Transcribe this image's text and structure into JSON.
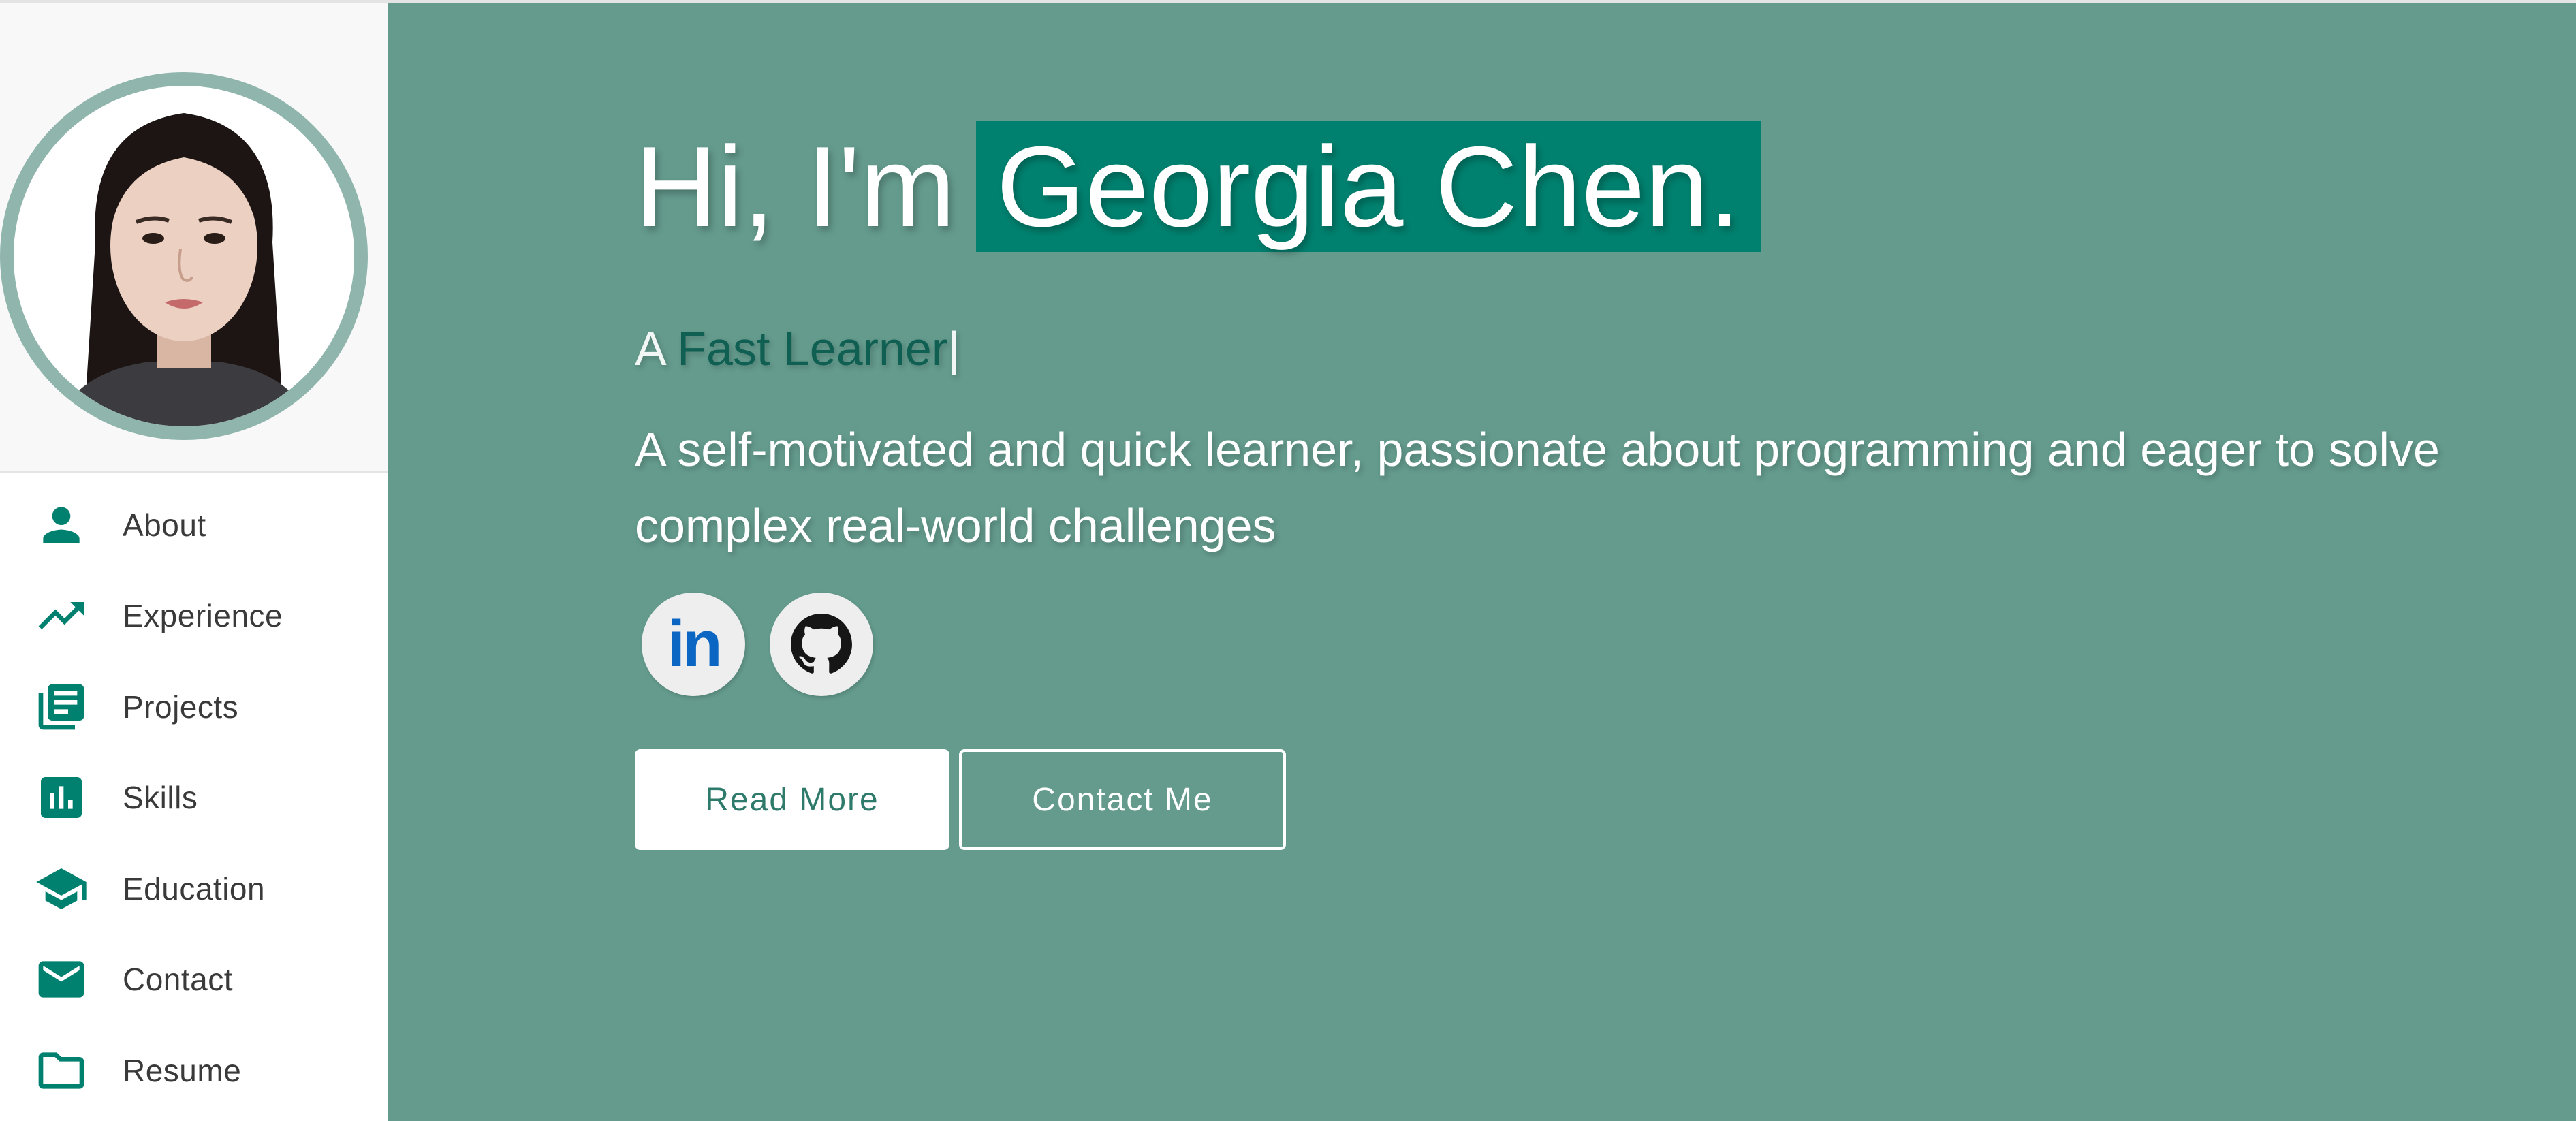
{
  "profile": {
    "avatar_alt": "Georgia Chen profile photo"
  },
  "sidebar": {
    "items": [
      {
        "label": "About",
        "icon": "person-icon"
      },
      {
        "label": "Experience",
        "icon": "trending-up-icon"
      },
      {
        "label": "Projects",
        "icon": "library-books-icon"
      },
      {
        "label": "Skills",
        "icon": "bar-chart-icon"
      },
      {
        "label": "Education",
        "icon": "graduation-cap-icon"
      },
      {
        "label": "Contact",
        "icon": "mail-icon"
      },
      {
        "label": "Resume",
        "icon": "folder-icon"
      }
    ]
  },
  "hero": {
    "greeting": "Hi, I'm",
    "name": "Georgia Chen.",
    "subtitle_prefix": "A",
    "subtitle_accent": "Fast Learner",
    "subtitle_cursor": "|",
    "description": "A self-motivated and quick learner, passionate about programming and eager to solve complex real-world challenges",
    "social": [
      {
        "label": "in",
        "icon": "linkedin-icon"
      },
      {
        "icon": "github-icon"
      }
    ],
    "read_more_label": "Read More",
    "contact_label": "Contact Me"
  },
  "colors": {
    "hero_bg": "#649b8d",
    "accent": "#00816f",
    "icon": "#00816f",
    "avatar_ring": "#8fb5ad"
  }
}
